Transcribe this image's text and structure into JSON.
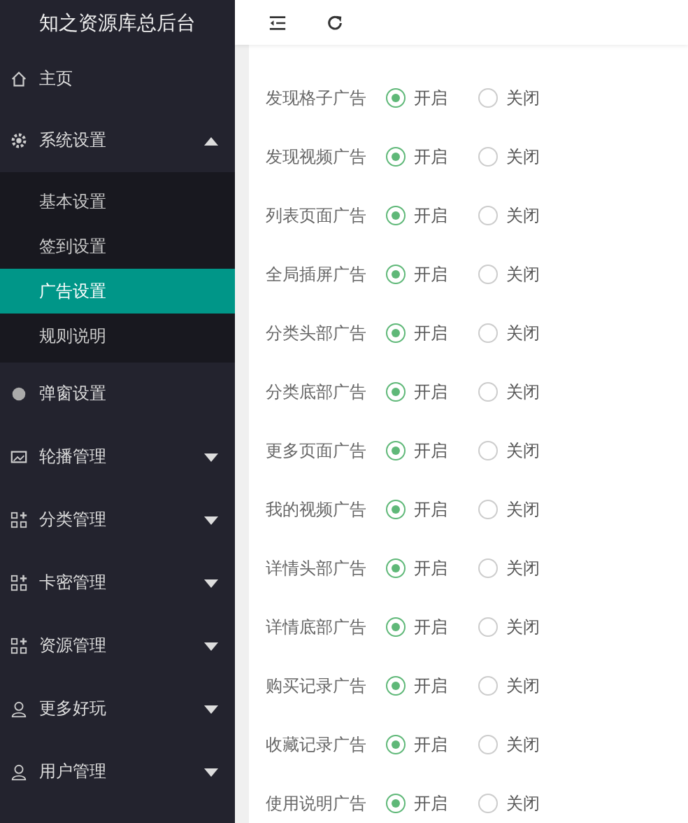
{
  "sidebar": {
    "title": "知之资源库总后台",
    "items": [
      {
        "label": "主页",
        "kind": "home"
      },
      {
        "label": "系统设置",
        "kind": "gear",
        "expanded": true,
        "children": [
          {
            "label": "基本设置",
            "selected": false
          },
          {
            "label": "签到设置",
            "selected": false
          },
          {
            "label": "广告设置",
            "selected": true
          },
          {
            "label": "规则说明",
            "selected": false
          }
        ]
      },
      {
        "label": "弹窗设置",
        "kind": "dot"
      },
      {
        "label": "轮播管理",
        "kind": "image",
        "expanded": false
      },
      {
        "label": "分类管理",
        "kind": "grid",
        "expanded": false
      },
      {
        "label": "卡密管理",
        "kind": "grid",
        "expanded": false
      },
      {
        "label": "资源管理",
        "kind": "grid",
        "expanded": false
      },
      {
        "label": "更多好玩",
        "kind": "user",
        "expanded": false
      },
      {
        "label": "用户管理",
        "kind": "user",
        "expanded": false
      }
    ]
  },
  "settings": [
    {
      "label": "发现格子广告",
      "options": [
        {
          "label": "开启",
          "selected": true
        },
        {
          "label": "关闭",
          "selected": false
        }
      ]
    },
    {
      "label": "发现视频广告",
      "options": [
        {
          "label": "开启",
          "selected": true
        },
        {
          "label": "关闭",
          "selected": false
        }
      ]
    },
    {
      "label": "列表页面广告",
      "options": [
        {
          "label": "开启",
          "selected": true
        },
        {
          "label": "关闭",
          "selected": false
        }
      ]
    },
    {
      "label": "全局插屏广告",
      "options": [
        {
          "label": "开启",
          "selected": true
        },
        {
          "label": "关闭",
          "selected": false
        }
      ]
    },
    {
      "label": "分类头部广告",
      "options": [
        {
          "label": "开启",
          "selected": true
        },
        {
          "label": "关闭",
          "selected": false
        }
      ]
    },
    {
      "label": "分类底部广告",
      "options": [
        {
          "label": "开启",
          "selected": true
        },
        {
          "label": "关闭",
          "selected": false
        }
      ]
    },
    {
      "label": "更多页面广告",
      "options": [
        {
          "label": "开启",
          "selected": true
        },
        {
          "label": "关闭",
          "selected": false
        }
      ]
    },
    {
      "label": "我的视频广告",
      "options": [
        {
          "label": "开启",
          "selected": true
        },
        {
          "label": "关闭",
          "selected": false
        }
      ]
    },
    {
      "label": "详情头部广告",
      "options": [
        {
          "label": "开启",
          "selected": true
        },
        {
          "label": "关闭",
          "selected": false
        }
      ]
    },
    {
      "label": "详情底部广告",
      "options": [
        {
          "label": "开启",
          "selected": true
        },
        {
          "label": "关闭",
          "selected": false
        }
      ]
    },
    {
      "label": "购买记录广告",
      "options": [
        {
          "label": "开启",
          "selected": true
        },
        {
          "label": "关闭",
          "selected": false
        }
      ]
    },
    {
      "label": "收藏记录广告",
      "options": [
        {
          "label": "开启",
          "selected": true
        },
        {
          "label": "关闭",
          "selected": false
        }
      ]
    },
    {
      "label": "使用说明广告",
      "options": [
        {
          "label": "开启",
          "selected": true
        },
        {
          "label": "关闭",
          "selected": false
        }
      ]
    }
  ]
}
